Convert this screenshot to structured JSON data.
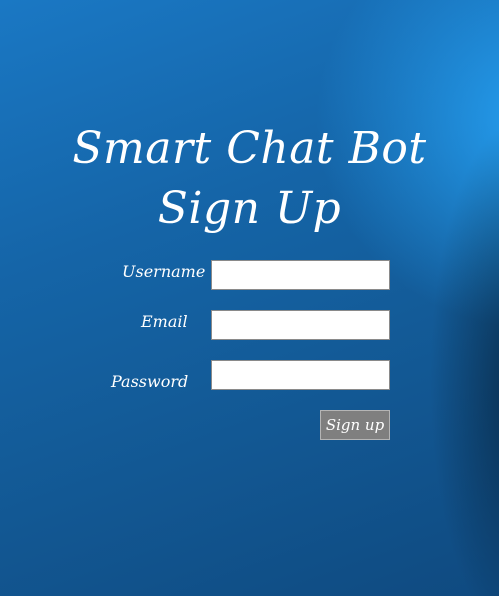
{
  "app": {
    "title_line1": "Smart Chat Bot",
    "title_line2": "Sign Up"
  },
  "form": {
    "username": {
      "label": "Username",
      "value": "",
      "placeholder": ""
    },
    "email": {
      "label": "Email",
      "value": "",
      "placeholder": ""
    },
    "password": {
      "label": "Password",
      "value": "",
      "placeholder": ""
    },
    "submit_label": "Sign up"
  },
  "colors": {
    "background_primary": "#1565a8",
    "background_highlight": "#28aaff",
    "button_background": "#7f7f7f",
    "text": "#ffffff"
  }
}
